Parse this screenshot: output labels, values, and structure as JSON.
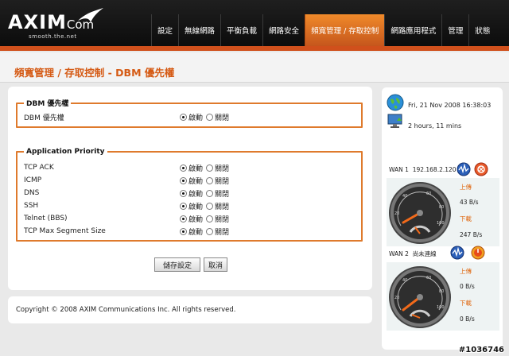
{
  "header": {
    "brand_main": "AXIM",
    "brand_suffix": "Com",
    "tagline": "smooth.the.net"
  },
  "nav": [
    {
      "label": "設定"
    },
    {
      "label": "無線網路"
    },
    {
      "label": "平衡負載"
    },
    {
      "label": "網路安全"
    },
    {
      "label": "頻寬管理 / 存取控制",
      "active": true
    },
    {
      "label": "網路應用程式"
    },
    {
      "label": "管理"
    },
    {
      "label": "狀態"
    }
  ],
  "page": {
    "title": "頻寬管理 / 存取控制 - DBM 優先權"
  },
  "dbm": {
    "legend": "DBM 優先權",
    "rows": [
      {
        "label": "DBM 優先權",
        "on_label": "啟動",
        "off_label": "關閉",
        "value": "on"
      }
    ]
  },
  "priority": {
    "legend": "Application Priority",
    "rows": [
      {
        "label": "TCP ACK",
        "on_label": "啟動",
        "off_label": "關閉",
        "value": "on"
      },
      {
        "label": "ICMP",
        "on_label": "啟動",
        "off_label": "關閉",
        "value": "on"
      },
      {
        "label": "DNS",
        "on_label": "啟動",
        "off_label": "關閉",
        "value": "on"
      },
      {
        "label": "SSH",
        "on_label": "啟動",
        "off_label": "關閉",
        "value": "on"
      },
      {
        "label": "Telnet (BBS)",
        "on_label": "啟動",
        "off_label": "關閉",
        "value": "on"
      },
      {
        "label": "TCP Max Segment Size",
        "on_label": "啟動",
        "off_label": "關閉",
        "value": "on"
      }
    ]
  },
  "buttons": {
    "save": "儲存設定",
    "cancel": "取消"
  },
  "footer": {
    "copyright": "Copyright © 2008 AXIM Communications Inc. All rights reserved."
  },
  "status": {
    "datetime": "Fri, 21 Nov 2008 16:38:03",
    "uptime": "2 hours, 11 mins",
    "wans": [
      {
        "label": "WAN 1",
        "ip": "192.168.2.120",
        "up_label": "上傳",
        "up_speed": "43 B/s",
        "down_label": "下載",
        "down_speed": "247 B/s",
        "scale": [
          "20",
          "40",
          "60",
          "80",
          "100"
        ]
      },
      {
        "label": "WAN 2",
        "ip": "尚未連線",
        "up_label": "上傳",
        "up_speed": "0 B/s",
        "down_label": "下載",
        "down_speed": "0 B/s",
        "scale": [
          "20",
          "40",
          "60",
          "80",
          "100"
        ]
      }
    ]
  },
  "watermark": "#1036746",
  "colors": {
    "accent": "#d55a14",
    "nav_active": "#e2782a",
    "fieldset_border": "#df7a2c",
    "header_bg": "#111111"
  }
}
